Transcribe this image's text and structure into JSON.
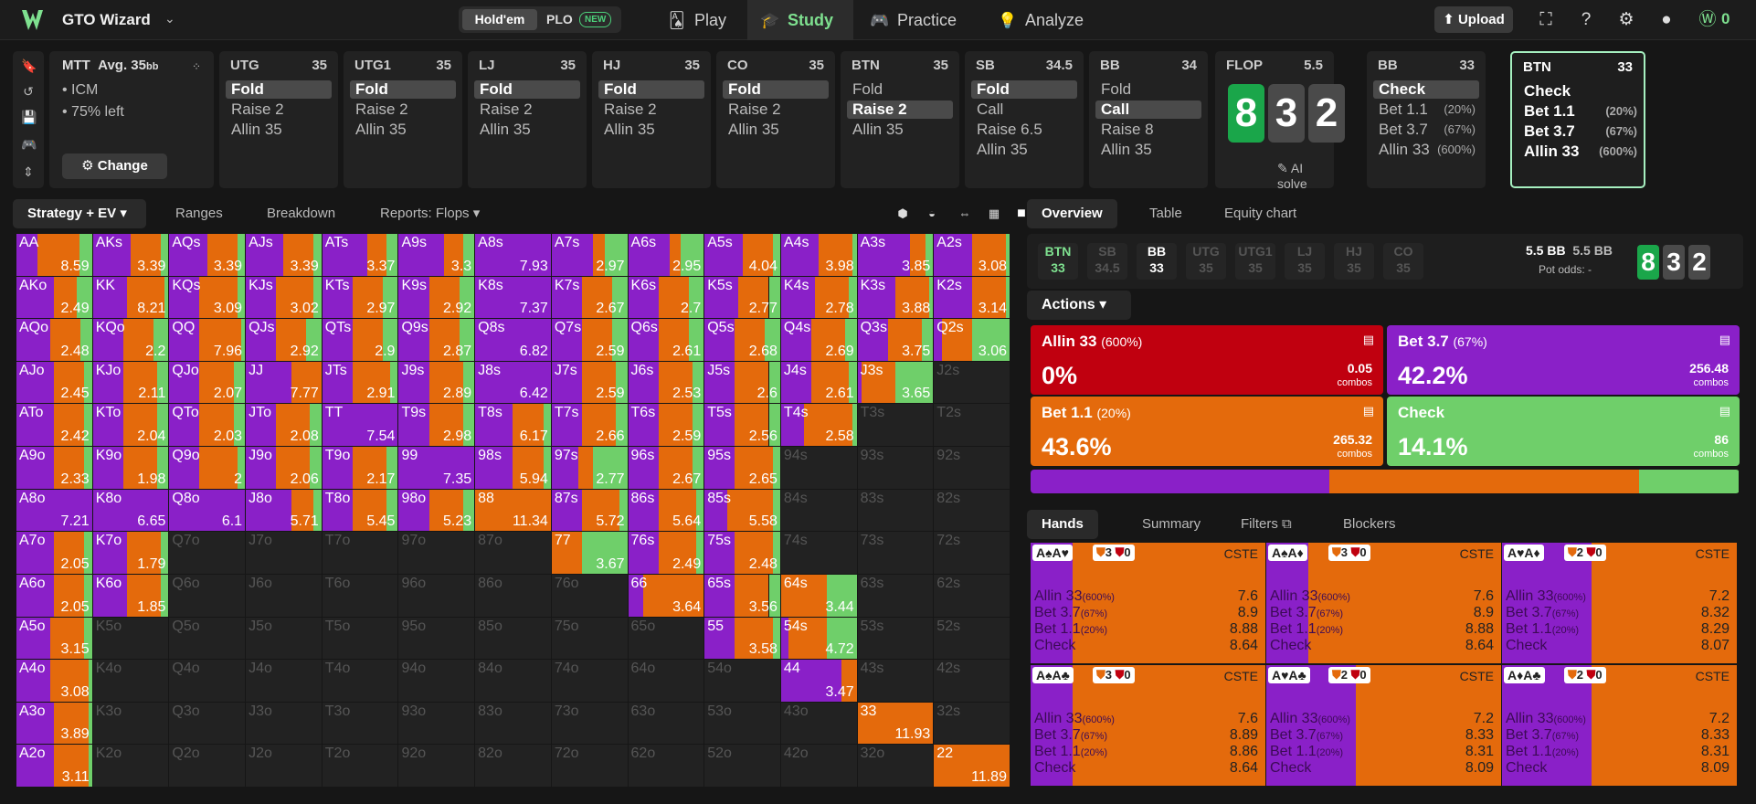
{
  "app": {
    "title": "GTO Wizard",
    "holdem": "Hold'em",
    "plo": "PLO",
    "new_badge": "NEW",
    "coins": "0"
  },
  "nav": [
    {
      "label": "Play",
      "icon": "cards-icon"
    },
    {
      "label": "Study",
      "icon": "study-cap-icon"
    },
    {
      "label": "Practice",
      "icon": "gamepad-icon"
    },
    {
      "label": "Analyze",
      "icon": "bulb-icon"
    }
  ],
  "topbar": {
    "upload": "Upload"
  },
  "mtt": {
    "title": "MTT",
    "avg": "Avg. 35",
    "avg_unit": "bb",
    "icm": "• ICM",
    "left": "• 75% left",
    "change": "Change"
  },
  "positions": [
    {
      "name": "UTG",
      "stack": "35",
      "actions": [
        {
          "label": "Fold",
          "sel": true
        },
        {
          "label": "Raise 2"
        },
        {
          "label": "Allin 35"
        }
      ]
    },
    {
      "name": "UTG1",
      "stack": "35",
      "actions": [
        {
          "label": "Fold",
          "sel": true
        },
        {
          "label": "Raise 2"
        },
        {
          "label": "Allin 35"
        }
      ]
    },
    {
      "name": "LJ",
      "stack": "35",
      "actions": [
        {
          "label": "Fold",
          "sel": true
        },
        {
          "label": "Raise 2"
        },
        {
          "label": "Allin 35"
        }
      ]
    },
    {
      "name": "HJ",
      "stack": "35",
      "actions": [
        {
          "label": "Fold",
          "sel": true
        },
        {
          "label": "Raise 2"
        },
        {
          "label": "Allin 35"
        }
      ]
    },
    {
      "name": "CO",
      "stack": "35",
      "actions": [
        {
          "label": "Fold",
          "sel": true
        },
        {
          "label": "Raise 2"
        },
        {
          "label": "Allin 35"
        }
      ]
    },
    {
      "name": "BTN",
      "stack": "35",
      "actions": [
        {
          "label": "Fold"
        },
        {
          "label": "Raise 2",
          "sel": true
        },
        {
          "label": "Allin 35"
        }
      ]
    },
    {
      "name": "SB",
      "stack": "34.5",
      "actions": [
        {
          "label": "Fold",
          "sel": true
        },
        {
          "label": "Call"
        },
        {
          "label": "Raise 6.5"
        },
        {
          "label": "Allin 35"
        }
      ]
    },
    {
      "name": "BB",
      "stack": "34",
      "actions": [
        {
          "label": "Fold"
        },
        {
          "label": "Call",
          "sel": true
        },
        {
          "label": "Raise 8"
        },
        {
          "label": "Allin 35"
        }
      ]
    }
  ],
  "flop": {
    "label": "FLOP",
    "pot": "5.5",
    "cards": [
      "8",
      "3",
      "2"
    ],
    "ai_solve": "AI solve"
  },
  "bbnode": {
    "name": "BB",
    "stack": "33",
    "actions": [
      {
        "label": "Check",
        "sel": true
      },
      {
        "label": "Bet 1.1",
        "pct": "(20%)"
      },
      {
        "label": "Bet 3.7",
        "pct": "(67%)"
      },
      {
        "label": "Allin 33",
        "pct": "(600%)"
      }
    ]
  },
  "btnnode": {
    "name": "BTN",
    "stack": "33",
    "actions": [
      {
        "label": "Check"
      },
      {
        "label": "Bet 1.1",
        "pct": "(20%)"
      },
      {
        "label": "Bet 3.7",
        "pct": "(67%)"
      },
      {
        "label": "Allin 33",
        "pct": "(600%)"
      }
    ]
  },
  "lefttabs": [
    "Strategy + EV",
    "Ranges",
    "Breakdown",
    "Reports: Flops"
  ],
  "righttabs": [
    "Overview",
    "Table",
    "Equity chart"
  ],
  "seats": [
    {
      "n": "BTN",
      "s": "33"
    },
    {
      "n": "SB",
      "s": "34.5"
    },
    {
      "n": "BB",
      "s": "33"
    },
    {
      "n": "UTG",
      "s": "35"
    },
    {
      "n": "UTG1",
      "s": "35"
    },
    {
      "n": "LJ",
      "s": "35"
    },
    {
      "n": "HJ",
      "s": "35"
    },
    {
      "n": "CO",
      "s": "35"
    }
  ],
  "pot": {
    "a": "5.5 BB",
    "b": "5.5 BB",
    "odds": "Pot odds:  -"
  },
  "actions_label": "Actions",
  "actionboxes": [
    {
      "name": "Allin 33",
      "size": "(600%)",
      "pct": "0%",
      "combos": "0.05",
      "color": "#c0000f"
    },
    {
      "name": "Bet 3.7",
      "size": "(67%)",
      "pct": "42.2%",
      "combos": "256.48",
      "color": "#8a20c8"
    },
    {
      "name": "Bet 1.1",
      "size": "(20%)",
      "pct": "43.6%",
      "combos": "265.32",
      "color": "#e46a0c"
    },
    {
      "name": "Check",
      "size": "",
      "pct": "14.1%",
      "combos": "86",
      "color": "#6fcf6a"
    }
  ],
  "combos_word": "combos",
  "freq": {
    "bet37": 42.2,
    "bet11": 43.6,
    "check": 14.1
  },
  "handtabs": [
    "Hands",
    "Summary",
    "Filters",
    "Blockers"
  ],
  "combocards": [
    {
      "cards": "A♠A♥",
      "b1": "3",
      "b2": "0",
      "pp": 10,
      "vals": [
        "7.6",
        "8.9",
        "8.88",
        "8.64"
      ]
    },
    {
      "cards": "A♠A♦",
      "b1": "3",
      "b2": "0",
      "pp": 10,
      "vals": [
        "7.6",
        "8.9",
        "8.88",
        "8.64"
      ]
    },
    {
      "cards": "A♥A♦",
      "b1": "2",
      "b2": "0",
      "pp": 30,
      "vals": [
        "7.2",
        "8.32",
        "8.29",
        "8.07"
      ]
    },
    {
      "cards": "A♠A♣",
      "b1": "3",
      "b2": "0",
      "pp": 10,
      "vals": [
        "7.6",
        "8.89",
        "8.86",
        "8.64"
      ]
    },
    {
      "cards": "A♥A♣",
      "b1": "2",
      "b2": "0",
      "pp": 30,
      "vals": [
        "7.2",
        "8.33",
        "8.31",
        "8.09"
      ]
    },
    {
      "cards": "A♦A♣",
      "b1": "2",
      "b2": "0",
      "pp": 30,
      "vals": [
        "7.2",
        "8.33",
        "8.31",
        "8.09"
      ]
    }
  ],
  "combolabels": [
    {
      "a": "Allin 33",
      "s": "(600%)"
    },
    {
      "a": "Bet 3.7",
      "s": "(67%)"
    },
    {
      "a": "Bet 1.1",
      "s": "(20%)"
    },
    {
      "a": "Check",
      "s": ""
    }
  ],
  "cste": "CSTE",
  "matrix": [
    [
      {
        "h": "AA",
        "e": "8.59",
        "p": 28,
        "o": 55
      },
      {
        "h": "AKs",
        "e": "3.39",
        "p": 50,
        "o": 40
      },
      {
        "h": "AQs",
        "e": "3.39",
        "p": 50,
        "o": 40
      },
      {
        "h": "AJs",
        "e": "3.39",
        "p": 50,
        "o": 40
      },
      {
        "h": "ATs",
        "e": "3.37",
        "p": 60,
        "o": 25
      },
      {
        "h": "A9s",
        "e": "3.3",
        "p": 60,
        "o": 25
      },
      {
        "h": "A8s",
        "e": "7.93",
        "p": 100,
        "o": 0
      },
      {
        "h": "A7s",
        "e": "2.97",
        "p": 55,
        "o": 15
      },
      {
        "h": "A6s",
        "e": "2.95",
        "p": 55,
        "o": 15
      },
      {
        "h": "A5s",
        "e": "4.04",
        "p": 50,
        "o": 40
      },
      {
        "h": "A4s",
        "e": "3.98",
        "p": 50,
        "o": 45
      },
      {
        "h": "A3s",
        "e": "3.85",
        "p": 70,
        "o": 20
      },
      {
        "h": "A2s",
        "e": "3.08",
        "p": 50,
        "o": 45
      }
    ],
    [
      {
        "h": "AKo",
        "e": "2.49",
        "p": 50,
        "o": 30
      },
      {
        "h": "KK",
        "e": "8.21",
        "p": 45,
        "o": 50
      },
      {
        "h": "KQs",
        "e": "3.09",
        "p": 40,
        "o": 50
      },
      {
        "h": "KJs",
        "e": "3.02",
        "p": 40,
        "o": 50
      },
      {
        "h": "KTs",
        "e": "2.97",
        "p": 40,
        "o": 40
      },
      {
        "h": "K9s",
        "e": "2.92",
        "p": 40,
        "o": 40
      },
      {
        "h": "K8s",
        "e": "7.37",
        "p": 100,
        "o": 0
      },
      {
        "h": "K7s",
        "e": "2.67",
        "p": 40,
        "o": 40
      },
      {
        "h": "K6s",
        "e": "2.7",
        "p": 40,
        "o": 40
      },
      {
        "h": "K5s",
        "e": "2.77",
        "p": 45,
        "o": 40
      },
      {
        "h": "K4s",
        "e": "2.78",
        "p": 45,
        "o": 45
      },
      {
        "h": "K3s",
        "e": "3.88",
        "p": 50,
        "o": 45
      },
      {
        "h": "K2s",
        "e": "3.14",
        "p": 50,
        "o": 45
      }
    ],
    [
      {
        "h": "AQo",
        "e": "2.48",
        "p": 45,
        "o": 40
      },
      {
        "h": "KQo",
        "e": "2.2",
        "p": 40,
        "o": 40
      },
      {
        "h": "QQ",
        "e": "7.96",
        "p": 40,
        "o": 55
      },
      {
        "h": "QJs",
        "e": "2.92",
        "p": 40,
        "o": 40
      },
      {
        "h": "QTs",
        "e": "2.9",
        "p": 40,
        "o": 40
      },
      {
        "h": "Q9s",
        "e": "2.87",
        "p": 40,
        "o": 40
      },
      {
        "h": "Q8s",
        "e": "6.82",
        "p": 100,
        "o": 0
      },
      {
        "h": "Q7s",
        "e": "2.59",
        "p": 40,
        "o": 40
      },
      {
        "h": "Q6s",
        "e": "2.61",
        "p": 40,
        "o": 40
      },
      {
        "h": "Q5s",
        "e": "2.68",
        "p": 40,
        "o": 40
      },
      {
        "h": "Q4s",
        "e": "2.69",
        "p": 40,
        "o": 45
      },
      {
        "h": "Q3s",
        "e": "3.75",
        "p": 40,
        "o": 45
      },
      {
        "h": "Q2s",
        "e": "3.06",
        "p": 10,
        "o": 40
      }
    ],
    [
      {
        "h": "AJo",
        "e": "2.45",
        "p": 50,
        "o": 40
      },
      {
        "h": "KJo",
        "e": "2.11",
        "p": 40,
        "o": 45
      },
      {
        "h": "QJo",
        "e": "2.07",
        "p": 40,
        "o": 45
      },
      {
        "h": "JJ",
        "e": "7.77",
        "p": 60,
        "o": 40
      },
      {
        "h": "JTs",
        "e": "2.91",
        "p": 40,
        "o": 50
      },
      {
        "h": "J9s",
        "e": "2.89",
        "p": 40,
        "o": 45
      },
      {
        "h": "J8s",
        "e": "6.42",
        "p": 100,
        "o": 0
      },
      {
        "h": "J7s",
        "e": "2.59",
        "p": 40,
        "o": 45
      },
      {
        "h": "J6s",
        "e": "2.53",
        "p": 40,
        "o": 45
      },
      {
        "h": "J5s",
        "e": "2.6",
        "p": 40,
        "o": 45
      },
      {
        "h": "J4s",
        "e": "2.61",
        "p": 40,
        "o": 50
      },
      {
        "h": "J3s",
        "e": "3.65",
        "p": 5,
        "o": 45
      },
      null
    ],
    [
      {
        "h": "ATo",
        "e": "2.42",
        "p": 50,
        "o": 40
      },
      {
        "h": "KTo",
        "e": "2.04",
        "p": 40,
        "o": 45
      },
      {
        "h": "QTo",
        "e": "2.03",
        "p": 40,
        "o": 45
      },
      {
        "h": "JTo",
        "e": "2.08",
        "p": 40,
        "o": 45
      },
      {
        "h": "TT",
        "e": "7.54",
        "p": 100,
        "o": 0
      },
      {
        "h": "T9s",
        "e": "2.98",
        "p": 40,
        "o": 45
      },
      {
        "h": "T8s",
        "e": "6.17",
        "p": 50,
        "o": 40
      },
      {
        "h": "T7s",
        "e": "2.66",
        "p": 40,
        "o": 45
      },
      {
        "h": "T6s",
        "e": "2.59",
        "p": 40,
        "o": 45
      },
      {
        "h": "T5s",
        "e": "2.56",
        "p": 40,
        "o": 45
      },
      {
        "h": "T4s",
        "e": "2.58",
        "p": 30,
        "o": 65
      },
      null,
      null
    ],
    [
      {
        "h": "A9o",
        "e": "2.33",
        "p": 50,
        "o": 40
      },
      {
        "h": "K9o",
        "e": "1.98",
        "p": 40,
        "o": 45
      },
      {
        "h": "Q9o",
        "e": "2",
        "p": 40,
        "o": 50
      },
      {
        "h": "J9o",
        "e": "2.06",
        "p": 40,
        "o": 45
      },
      {
        "h": "T9o",
        "e": "2.17",
        "p": 40,
        "o": 45
      },
      {
        "h": "99",
        "e": "7.35",
        "p": 100,
        "o": 0
      },
      {
        "h": "98s",
        "e": "5.94",
        "p": 50,
        "o": 40
      },
      {
        "h": "97s",
        "e": "2.77",
        "p": 35,
        "o": 20
      },
      {
        "h": "96s",
        "e": "2.67",
        "p": 40,
        "o": 45
      },
      {
        "h": "95s",
        "e": "2.65",
        "p": 40,
        "o": 50
      },
      null,
      null,
      null
    ],
    [
      {
        "h": "A8o",
        "e": "7.21",
        "p": 100,
        "o": 0
      },
      {
        "h": "K8o",
        "e": "6.65",
        "p": 100,
        "o": 0
      },
      {
        "h": "Q8o",
        "e": "6.1",
        "p": 100,
        "o": 0
      },
      {
        "h": "J8o",
        "e": "5.71",
        "p": 60,
        "o": 30
      },
      {
        "h": "T8o",
        "e": "5.45",
        "p": 40,
        "o": 45
      },
      {
        "h": "98o",
        "e": "5.23",
        "p": 40,
        "o": 45
      },
      {
        "h": "88",
        "e": "11.34",
        "p": 0,
        "o": 100
      },
      {
        "h": "87s",
        "e": "5.72",
        "p": 40,
        "o": 50
      },
      {
        "h": "86s",
        "e": "5.64",
        "p": 40,
        "o": 50
      },
      {
        "h": "85s",
        "e": "5.58",
        "p": 30,
        "o": 60
      },
      null,
      null,
      null
    ],
    [
      {
        "h": "A7o",
        "e": "2.05",
        "p": 50,
        "o": 40
      },
      {
        "h": "K7o",
        "e": "1.79",
        "p": 45,
        "o": 45
      },
      null,
      null,
      null,
      null,
      null,
      {
        "h": "77",
        "e": "3.67",
        "p": 0,
        "o": 40
      },
      {
        "h": "76s",
        "e": "2.49",
        "p": 40,
        "o": 50
      },
      {
        "h": "75s",
        "e": "2.48",
        "p": 40,
        "o": 50
      },
      null,
      null,
      null
    ],
    [
      {
        "h": "A6o",
        "e": "2.05",
        "p": 50,
        "o": 40
      },
      {
        "h": "K6o",
        "e": "1.85",
        "p": 45,
        "o": 45
      },
      null,
      null,
      null,
      null,
      null,
      null,
      {
        "h": "66",
        "e": "3.64",
        "p": 20,
        "o": 80
      },
      {
        "h": "65s",
        "e": "3.56",
        "p": 40,
        "o": 45
      },
      {
        "h": "64s",
        "e": "3.44",
        "p": 0,
        "o": 60
      },
      null,
      null
    ],
    [
      {
        "h": "A5o",
        "e": "3.15",
        "p": 45,
        "o": 45
      },
      null,
      null,
      null,
      null,
      null,
      null,
      null,
      null,
      {
        "h": "55",
        "e": "3.58",
        "p": 40,
        "o": 50
      },
      {
        "h": "54s",
        "e": "4.72",
        "p": 10,
        "o": 50
      },
      null,
      null
    ],
    [
      {
        "h": "A4o",
        "e": "3.08",
        "p": 45,
        "o": 50
      },
      null,
      null,
      null,
      null,
      null,
      null,
      null,
      null,
      null,
      {
        "h": "44",
        "e": "3.47",
        "p": 80,
        "o": 20
      },
      null,
      null
    ],
    [
      {
        "h": "A3o",
        "e": "3.89",
        "p": 50,
        "o": 45
      },
      null,
      null,
      null,
      null,
      null,
      null,
      null,
      null,
      null,
      null,
      {
        "h": "33",
        "e": "11.93",
        "p": 0,
        "o": 100
      },
      null
    ],
    [
      {
        "h": "A2o",
        "e": "3.11",
        "p": 50,
        "o": 45
      },
      null,
      null,
      null,
      null,
      null,
      null,
      null,
      null,
      null,
      null,
      null,
      {
        "h": "22",
        "e": "11.89",
        "p": 0,
        "o": 100
      }
    ]
  ],
  "colors": {
    "purple": "#8a20c8",
    "orange": "#e46a0c",
    "green": "#6fcf6a",
    "red": "#c0000f"
  }
}
